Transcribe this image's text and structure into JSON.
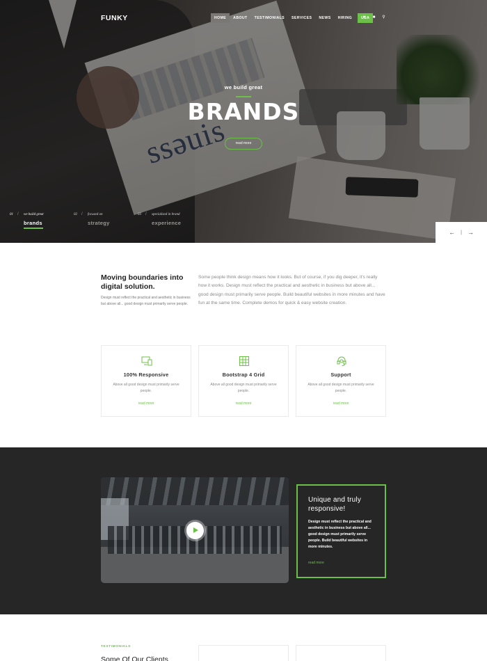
{
  "nav": {
    "logo": "FUNKY",
    "menu": [
      {
        "label": "HOME",
        "active": true
      },
      {
        "label": "ABOUT"
      },
      {
        "label": "TESTIMONIALS"
      },
      {
        "label": "SERVICES"
      },
      {
        "label": "NEWS"
      },
      {
        "label": "HIRING"
      },
      {
        "label": "USA",
        "cta": true
      }
    ],
    "icons": [
      "heart-icon",
      "bag-icon",
      "search-icon"
    ]
  },
  "hero": {
    "subtitle": "we build great",
    "title": "BRANDS",
    "button": "read more",
    "slides": [
      {
        "num": "01",
        "caption": "we build great",
        "word": "brands",
        "active": true
      },
      {
        "num": "02",
        "caption": "focused on",
        "word": "strategy"
      },
      {
        "num": "03",
        "caption": "specialized in brand",
        "word": "experience"
      }
    ],
    "arrows": {
      "prev": "←",
      "divider": "|",
      "next": "→"
    }
  },
  "intro": {
    "title": "Moving boundaries into digital solution.",
    "left_text": "Design must reflect the practical and aesthetic in business but above all... good design must primarily serve people.",
    "right_text": "Some people think design means how it looks. But of course, if you dig deeper, it's really how it works. Design must reflect the practical and aesthetic in business but above all... good design must primarily serve people. Build beautiful websites in more minutes and have fun at the same time. Complete demos for quick & easy website creation."
  },
  "features": [
    {
      "icon": "devices-icon",
      "title": "100% Responsive",
      "text": "Above all good design must primarily serve people.",
      "link": "read more"
    },
    {
      "icon": "grid-icon",
      "title": "Bootstrap 4 Grid",
      "text": "Above all good design must primarily serve people.",
      "link": "read more"
    },
    {
      "icon": "headset-icon",
      "title": "Support",
      "text": "Above all good design must primarily serve people.",
      "link": "read more"
    }
  ],
  "promo": {
    "title": "Unique and truly responsive!",
    "text": "Design must reflect the practical and aesthetic in business but above all... good design must primarily serve people. Build beautiful websites in more minutes.",
    "link": "read more"
  },
  "testimonials": {
    "label": "TESTIMONIALS",
    "title": "Some Of Our Clients"
  },
  "colors": {
    "accent": "#6cc04a",
    "dark": "#262626"
  }
}
